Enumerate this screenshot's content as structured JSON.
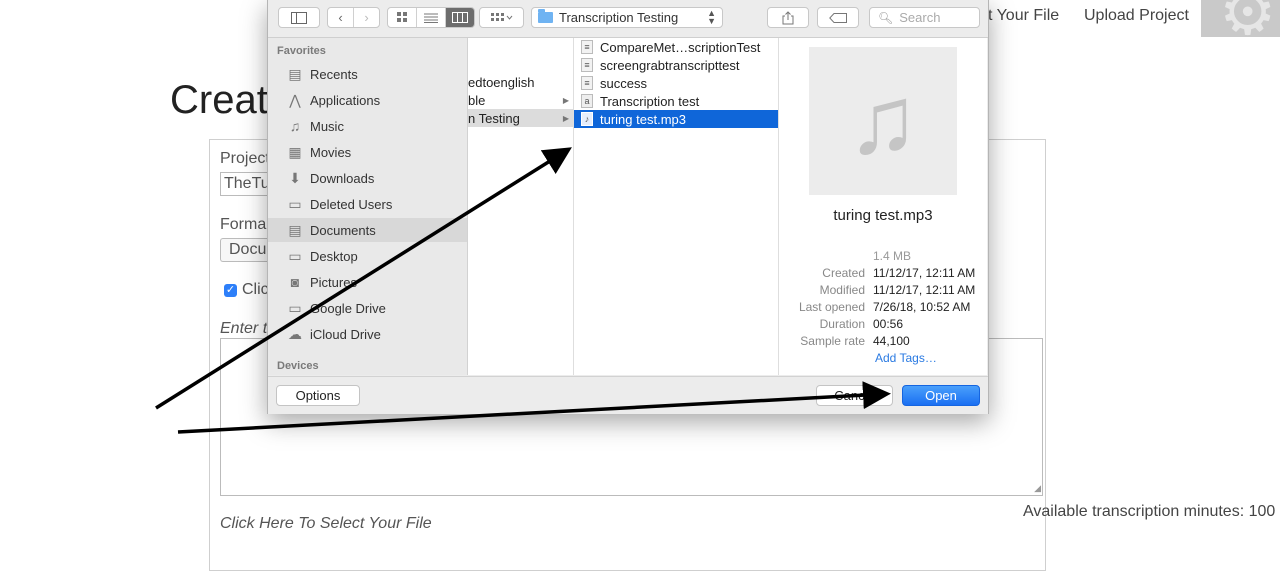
{
  "page": {
    "nav": {
      "partial_item": "t Your File",
      "upload_project": "Upload Project",
      "settings_icon": "gear-icon"
    },
    "title": "Create",
    "form": {
      "project_label": "Project",
      "project_value": "TheTu",
      "format_label": "Forma",
      "format_value": "Docu",
      "checkbox_label": "Clic",
      "enter_text": "Enter t",
      "select_file": "Click Here To Select Your File",
      "minutes": "Available transcription minutes: 100"
    }
  },
  "dialog": {
    "toolbar": {
      "location": "Transcription Testing",
      "search_placeholder": "Search"
    },
    "sidebar": {
      "favorites_header": "Favorites",
      "devices_header": "Devices",
      "items": [
        {
          "label": "Recents",
          "icon": "recents-icon"
        },
        {
          "label": "Applications",
          "icon": "applications-icon"
        },
        {
          "label": "Music",
          "icon": "music-icon"
        },
        {
          "label": "Movies",
          "icon": "movies-icon"
        },
        {
          "label": "Downloads",
          "icon": "downloads-icon"
        },
        {
          "label": "Deleted Users",
          "icon": "folder-icon"
        },
        {
          "label": "Documents",
          "icon": "documents-icon",
          "selected": true
        },
        {
          "label": "Desktop",
          "icon": "desktop-icon"
        },
        {
          "label": "Pictures",
          "icon": "pictures-icon"
        },
        {
          "label": "Google Drive",
          "icon": "folder-icon"
        },
        {
          "label": "iCloud Drive",
          "icon": "cloud-icon"
        }
      ]
    },
    "column1": [
      "edtoenglish",
      "ble",
      "n Testing"
    ],
    "column2": [
      {
        "name": "CompareMet…scriptionTest"
      },
      {
        "name": "screengrabtranscripttest"
      },
      {
        "name": "success"
      },
      {
        "name": "Transcription test"
      },
      {
        "name": "turing test.mp3",
        "selected": true
      }
    ],
    "preview": {
      "filename": "turing test.mp3",
      "size": "1.4 MB",
      "meta": [
        {
          "key": "Created",
          "value": "11/12/17, 12:11 AM"
        },
        {
          "key": "Modified",
          "value": "11/12/17, 12:11 AM"
        },
        {
          "key": "Last opened",
          "value": "7/26/18, 10:52 AM"
        },
        {
          "key": "Duration",
          "value": "00:56"
        },
        {
          "key": "Sample rate",
          "value": "44,100"
        }
      ],
      "add_tags": "Add Tags…"
    },
    "buttons": {
      "options": "Options",
      "cancel": "Cancel",
      "open": "Open"
    }
  },
  "colors": {
    "accent": "#1a6ff2",
    "selection": "#0f66d9",
    "annotation_arrow": "#000000"
  }
}
